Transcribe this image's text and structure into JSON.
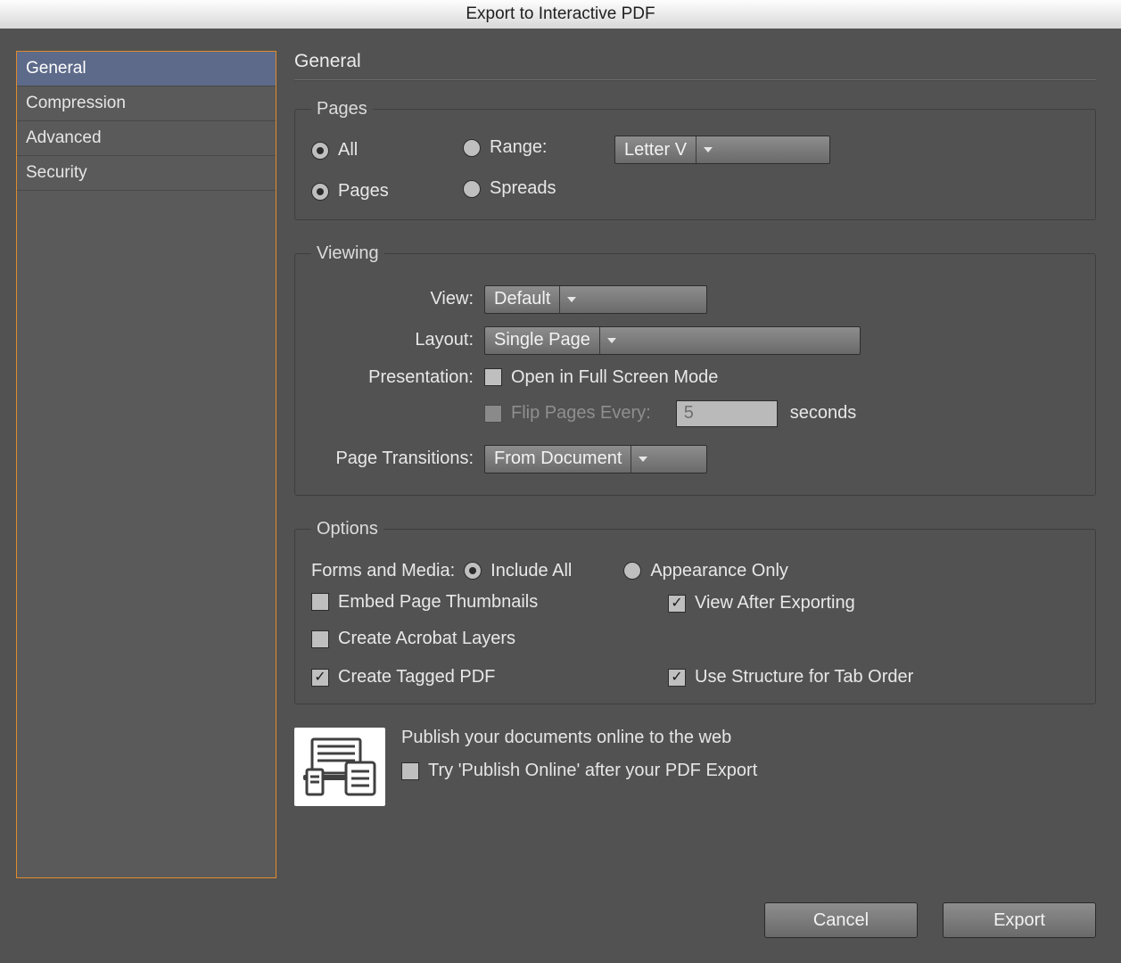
{
  "title": "Export to Interactive PDF",
  "sidebar": {
    "items": [
      {
        "label": "General"
      },
      {
        "label": "Compression"
      },
      {
        "label": "Advanced"
      },
      {
        "label": "Security"
      }
    ]
  },
  "panel": {
    "title": "General",
    "pages": {
      "legend": "Pages",
      "all": "All",
      "range": "Range:",
      "range_value": "Letter V",
      "pages": "Pages",
      "spreads": "Spreads"
    },
    "viewing": {
      "legend": "Viewing",
      "view_label": "View:",
      "view_value": "Default",
      "layout_label": "Layout:",
      "layout_value": "Single Page",
      "presentation_label": "Presentation:",
      "fullscreen": "Open in Full Screen Mode",
      "flip_label": "Flip Pages Every:",
      "flip_value": "5",
      "flip_unit": "seconds",
      "transitions_label": "Page Transitions:",
      "transitions_value": "From Document"
    },
    "options": {
      "legend": "Options",
      "forms_label": "Forms and Media:",
      "include_all": "Include All",
      "appearance_only": "Appearance Only",
      "embed_thumbs": "Embed Page Thumbnails",
      "view_after": "View After Exporting",
      "acrobat_layers": "Create Acrobat Layers",
      "tagged_pdf": "Create Tagged PDF",
      "tab_order": "Use Structure for Tab Order"
    },
    "promo": {
      "headline": "Publish your documents online to the web",
      "try_label": "Try 'Publish Online' after your PDF Export"
    }
  },
  "buttons": {
    "cancel": "Cancel",
    "export": "Export"
  }
}
